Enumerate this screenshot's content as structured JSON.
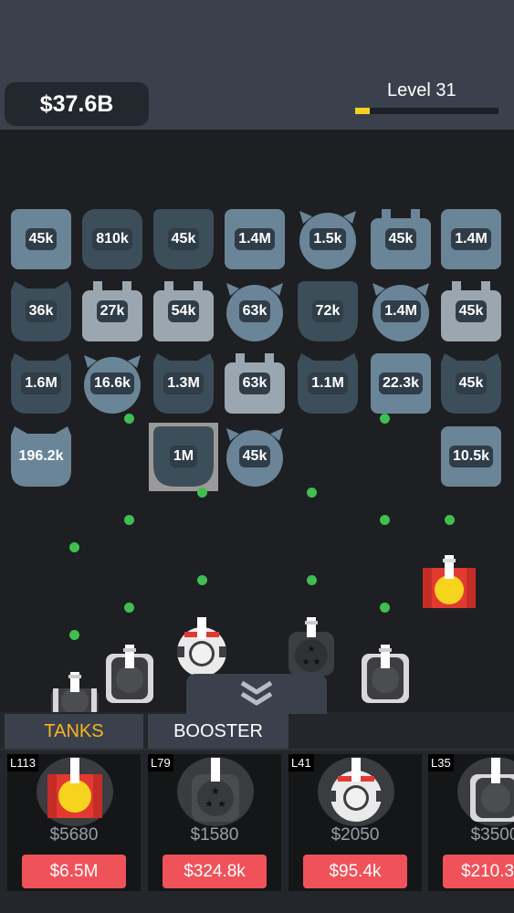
{
  "hud": {
    "money": "$37.6B",
    "level_label": "Level 31",
    "level_progress": 0.1
  },
  "grid": {
    "row1": [
      "45k",
      "810k",
      "45k",
      "1.4M",
      "1.5k",
      "45k",
      "1.4M"
    ],
    "row2": [
      "36k",
      "27k",
      "54k",
      "63k",
      "72k",
      "1.4M",
      "45k"
    ],
    "row3": [
      "1.6M",
      "16.6k",
      "1.3M",
      "63k",
      "1.1M",
      "22.3k",
      "45k"
    ],
    "row4": [
      "196.2k",
      "1M",
      "45k",
      "10.5k"
    ]
  },
  "shop": {
    "tabs": [
      "TANKS",
      "BOOSTER"
    ],
    "active_tab": "TANKS",
    "cards": [
      {
        "level": "L113",
        "cost": "$5680",
        "buy": "$6.5M",
        "icon": "red-yellow-tank-icon"
      },
      {
        "level": "L79",
        "cost": "$1580",
        "buy": "$324.8k",
        "icon": "star-tank-icon"
      },
      {
        "level": "L41",
        "cost": "$2050",
        "buy": "$95.4k",
        "icon": "white-red-tank-icon"
      },
      {
        "level": "L35",
        "cost": "$3500",
        "buy": "$210.3",
        "icon": "grey-tank-icon"
      }
    ]
  },
  "colors": {
    "accent_tab": "#f6b521",
    "buy_button": "#f0525a",
    "bullet": "#3fbf4f",
    "level_fill": "#f4d21d"
  }
}
